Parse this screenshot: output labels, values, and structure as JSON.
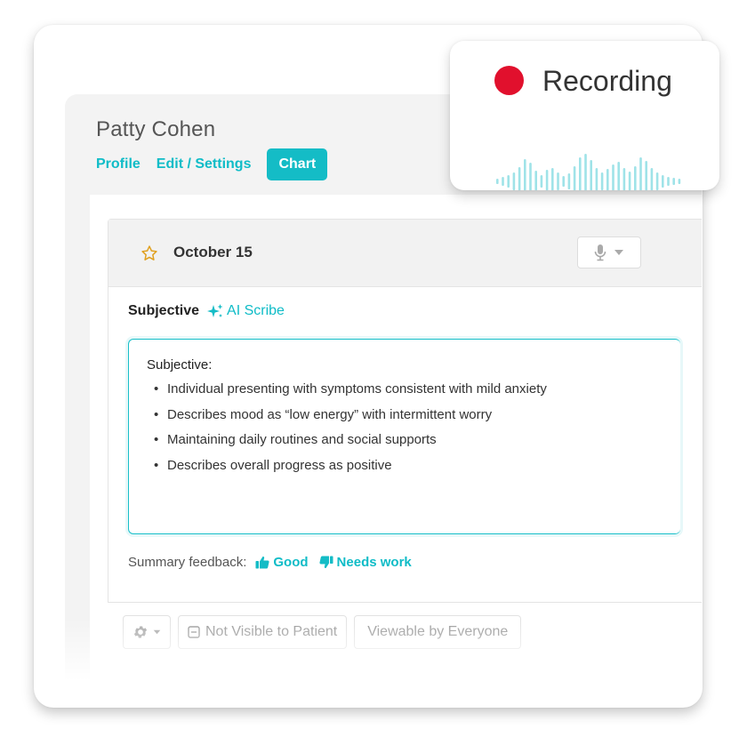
{
  "patient": {
    "name": "Patty Cohen"
  },
  "nav": {
    "profile": "Profile",
    "edit_settings": "Edit / Settings",
    "chart": "Chart"
  },
  "note": {
    "date": "October 15",
    "section_title": "Subjective",
    "ai_scribe_label": "AI Scribe",
    "box_heading": "Subjective:",
    "bullets": [
      "Individual presenting with symptoms consistent with mild anxiety",
      "Describes mood as “low energy” with intermittent worry",
      "Maintaining daily routines and social supports",
      "Describes overall progress as positive"
    ],
    "feedback_label": "Summary feedback:",
    "feedback_good": "Good",
    "feedback_needs_work": "Needs work"
  },
  "toolbar": {
    "not_visible": "Not Visible to Patient",
    "viewable": "Viewable by Everyone"
  },
  "recording": {
    "label": "Recording"
  },
  "colors": {
    "accent": "#14bcc6",
    "record_red": "#e1102d",
    "wave": "#9fe3e8"
  },
  "icons": [
    "star-icon",
    "microphone-icon",
    "chevron-down-icon",
    "sparkle-icon",
    "thumbs-up-icon",
    "thumbs-down-icon",
    "gear-icon",
    "checkbox-icon"
  ]
}
